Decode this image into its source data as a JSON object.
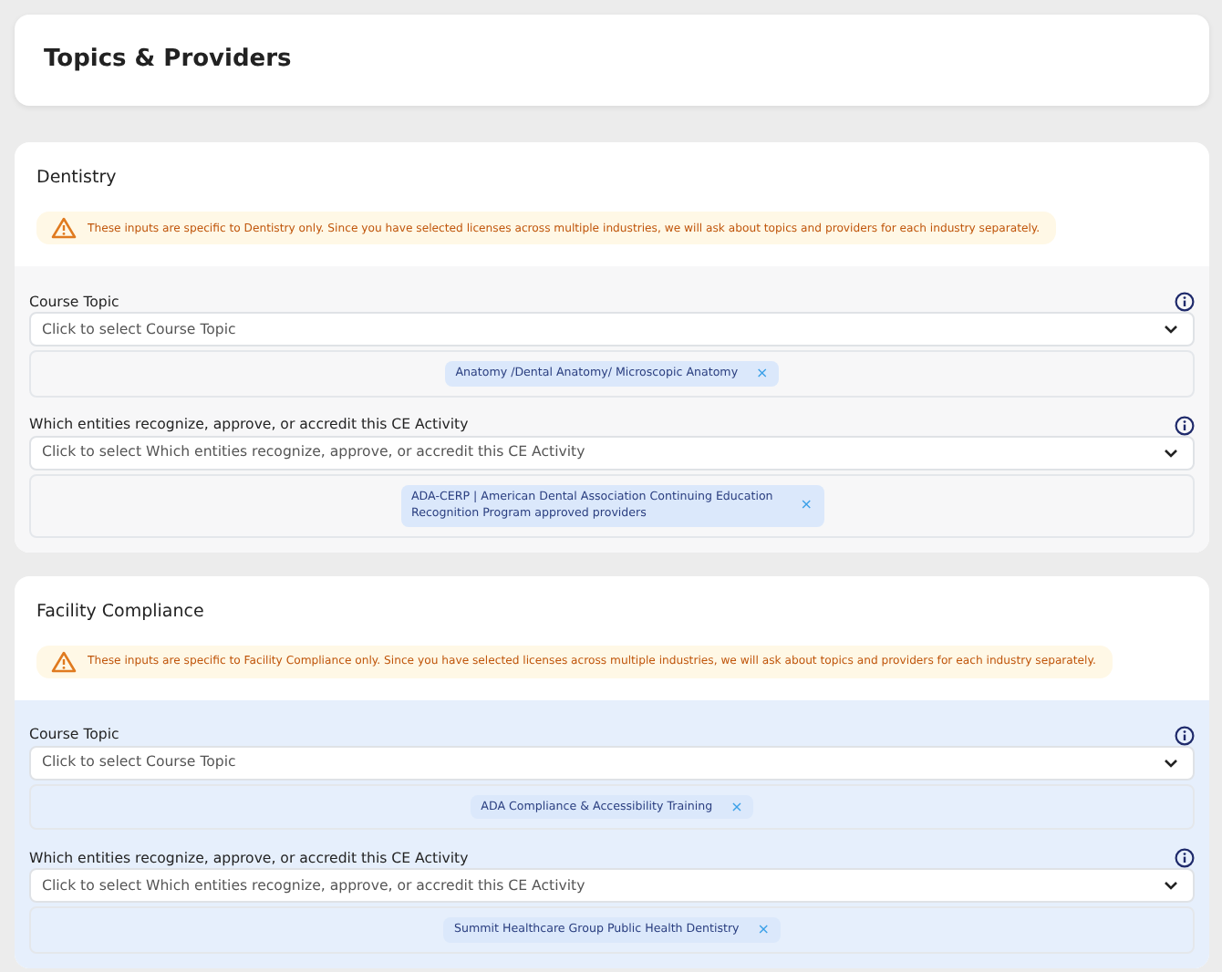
{
  "page_title": "Topics & Providers",
  "sections": [
    {
      "title": "Dentistry",
      "highlighted": false,
      "notice": "These inputs are specific to Dentistry only. Since you have selected licenses across multiple industries, we will ask about topics and providers for each industry separately.",
      "fields": [
        {
          "label": "Course Topic",
          "placeholder": "Click to select Course Topic",
          "chips": [
            "Anatomy /Dental Anatomy/ Microscopic Anatomy"
          ],
          "remove": "×"
        },
        {
          "label": "Which entities recognize, approve, or accredit this CE Activity",
          "placeholder": "Click to select Which entities recognize, approve, or accredit this CE Activity",
          "chips": [
            "ADA-CERP | American Dental Association Continuing Education Recognition Program approved providers"
          ],
          "remove": "×"
        }
      ]
    },
    {
      "title": "Facility Compliance",
      "highlighted": true,
      "notice": "These inputs are specific to Facility Compliance only. Since you have selected licenses across multiple industries, we will ask about topics and providers for each industry separately.",
      "fields": [
        {
          "label": "Course Topic",
          "placeholder": "Click to select Course Topic",
          "chips": [
            "ADA Compliance & Accessibility Training"
          ],
          "remove": "×"
        },
        {
          "label": "Which entities recognize, approve, or accredit this CE Activity",
          "placeholder": "Click to select Which entities recognize, approve, or accredit this CE Activity",
          "chips": [
            "Summit Healthcare Group Public Health Dentistry"
          ],
          "remove": "×"
        }
      ]
    }
  ]
}
